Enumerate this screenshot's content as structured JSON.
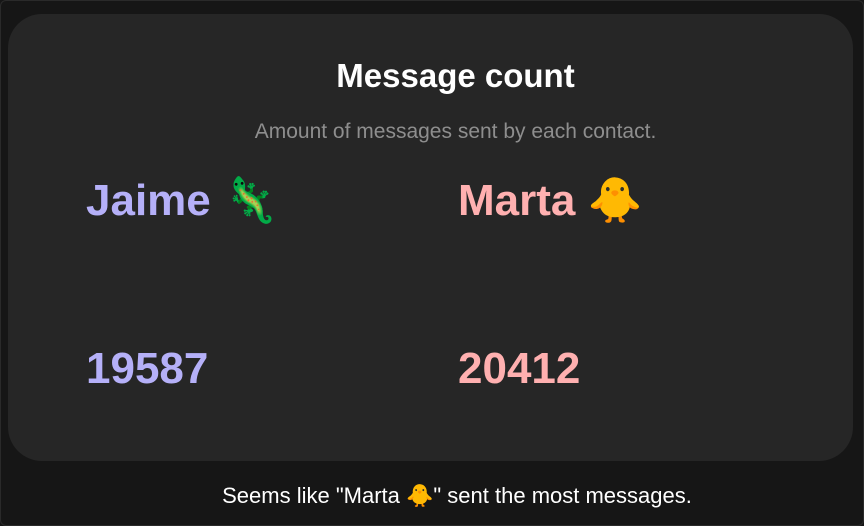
{
  "title": "Message count",
  "subtitle": "Amount of messages sent by each contact.",
  "contacts": [
    {
      "name": "Jaime 🦎",
      "count": "19587",
      "color": "#b5b0f8"
    },
    {
      "name": "Marta 🐥",
      "count": "20412",
      "color": "#ffb0b0"
    }
  ],
  "footer": "Seems like \"Marta 🐥\" sent the most messages.",
  "colors": {
    "background": "#161616",
    "card": "#262626",
    "title": "#ffffff",
    "subtitle": "#8e8e8e"
  }
}
